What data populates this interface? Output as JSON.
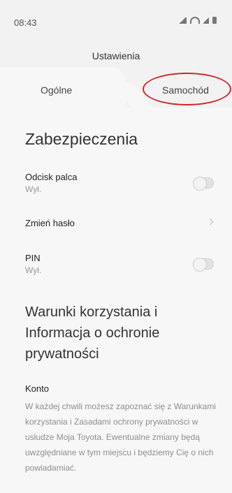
{
  "status_bar": {
    "time": "08:43"
  },
  "header": {
    "title": "Ustawienia"
  },
  "tabs": [
    {
      "label": "Ogólne",
      "active": true
    },
    {
      "label": "Samochód",
      "active": false
    }
  ],
  "security": {
    "title": "Zabezpieczenia",
    "fingerprint": {
      "label": "Odcisk palca",
      "status": "Wył."
    },
    "change_password": {
      "label": "Zmień hasło"
    },
    "pin": {
      "label": "PIN",
      "status": "Wył."
    }
  },
  "terms": {
    "title": "Warunki korzystania i Informacja o ochronie prywatności"
  },
  "account": {
    "heading": "Konto",
    "body": "W każdej chwili możesz zapoznać się z Warunkami korzystania i Zasadami ochrony prywatności w usłudze Moja Toyota. Ewentualne zmiany będą uwzględniane w tym miejscu i będziemy Cię o nich powiadamiać."
  },
  "colors": {
    "highlight": "#d0252c",
    "background": "#f7f7f7",
    "muted_text": "#8e8e8e"
  }
}
